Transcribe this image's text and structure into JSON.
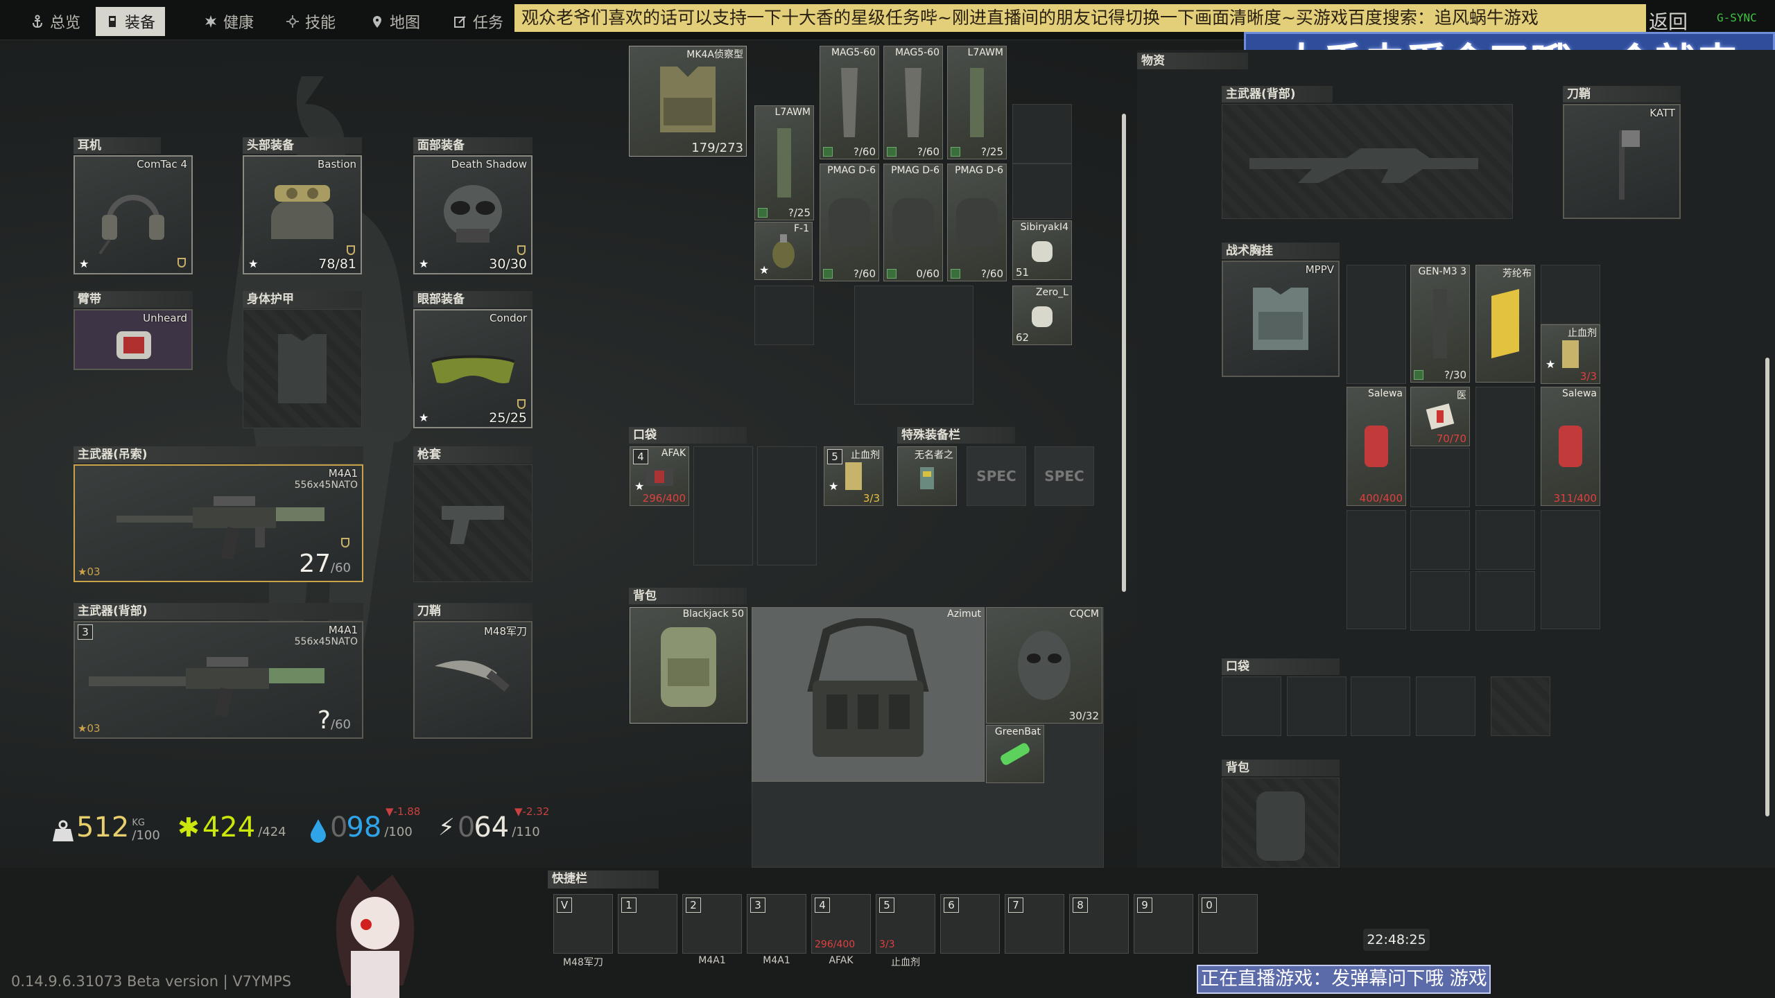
{
  "nav": {
    "tabs": [
      {
        "label": "总览",
        "icon": "anchor-icon",
        "active": false
      },
      {
        "label": "装备",
        "icon": "gear-person-icon",
        "active": true
      },
      {
        "label": "健康",
        "icon": "health-icon",
        "active": false
      },
      {
        "label": "技能",
        "icon": "skills-icon",
        "active": false
      },
      {
        "label": "地图",
        "icon": "map-pin-icon",
        "active": false
      },
      {
        "label": "任务",
        "icon": "tasks-icon",
        "active": false
      }
    ],
    "marquee": "观众老爷们喜欢的话可以支持一下十大香的星级任务哔~刚进直播间的朋友记得切换一下画面清晰度~买游戏百度搜索：追风蜗牛游戏",
    "back": "返回",
    "fps": "G-SYNC"
  },
  "stream": {
    "banner": "大香去觅食了哦一会就来",
    "live_status": "正在直播游戏：发弹幕问下哦 游戏",
    "clock": "22:48:25"
  },
  "gear": {
    "earpiece": {
      "title": "耳机",
      "name": "ComTac 4"
    },
    "headwear": {
      "title": "头部装备",
      "name": "Bastion",
      "value": "78/81"
    },
    "faceCover": {
      "title": "面部装备",
      "name": "Death Shadow",
      "value": "30/30"
    },
    "armband": {
      "title": "臂带",
      "name": "Unheard"
    },
    "bodyArmor": {
      "title": "身体护甲"
    },
    "eyewear": {
      "title": "眼部装备",
      "name": "Condor",
      "value": "25/25"
    },
    "primarySling": {
      "title": "主武器(吊索)",
      "name": "M4A1",
      "caliber": "556x45NATO",
      "ammo": "27",
      "ammoMax": "/60",
      "level": "03"
    },
    "holster": {
      "title": "枪套"
    },
    "primaryBack": {
      "title": "主武器(背部)",
      "name": "M4A1",
      "caliber": "556x45NATO",
      "ammo": "?",
      "ammoMax": "/60",
      "level": "03",
      "key": "3"
    },
    "scabbard": {
      "title": "刀鞘",
      "name": "M48军刀"
    }
  },
  "stats": {
    "weight": "512",
    "weightUnit": "KG",
    "weightMax": "/100",
    "health": "424",
    "healthMax": "/424",
    "hydration": "98",
    "hydrationMax": "/100",
    "hydrationDelta": "▼-1.88",
    "energy": "64",
    "energyMax": "/110",
    "energyDelta": "▼-2.32",
    "prefix": "0"
  },
  "rig": {
    "vest": {
      "name": "MK4A侦察型",
      "value": "179/273"
    },
    "items": [
      {
        "name": "MAG5-60",
        "value": "?/60"
      },
      {
        "name": "MAG5-60",
        "value": "?/60"
      },
      {
        "name": "L7AWM",
        "value": "?/25"
      },
      {
        "name": "L7AWM",
        "value": "?/25"
      },
      {
        "name": "F-1"
      },
      {
        "name": "PMAG D-6",
        "value": "?/60"
      },
      {
        "name": "PMAG D-6",
        "value": "0/60"
      },
      {
        "name": "PMAG D-6",
        "value": "?/60"
      },
      {
        "name": "SibiryakI4",
        "value": "51"
      },
      {
        "name": "Zero_L",
        "value": "62"
      }
    ]
  },
  "pockets": {
    "title": "口袋",
    "afak": {
      "key": "4",
      "name": "AFAK",
      "value": "296/400"
    }
  },
  "special": {
    "title": "特殊装备栏",
    "hemostat": {
      "key": "5",
      "name": "止血剂",
      "value": "3/3"
    },
    "marker": {
      "name": "无名者之"
    },
    "spec1": "SPEC",
    "spec2": "SPEC"
  },
  "backpack": {
    "title": "背包",
    "name": "Blackjack 50",
    "rig": "Azimut",
    "mask": {
      "name": "CQCM",
      "value": "30/32"
    },
    "stim": {
      "name": "GreenBat"
    }
  },
  "stash": {
    "title": "物资",
    "primary": {
      "title": "主武器(背部)"
    },
    "scabbard": {
      "title": "刀鞘",
      "name": "KATT"
    },
    "rig": {
      "title": "战术胸挂",
      "name": "MPPV",
      "items": [
        {
          "name": "GEN-M3 3",
          "value": "?/30"
        },
        {
          "name": "芳纶布"
        },
        {
          "name": "止血剂",
          "value": "3/3"
        },
        {
          "name": "Salewa",
          "value": "400/400"
        },
        {
          "name": "医",
          "value": "70/70"
        },
        {
          "name": "Salewa",
          "value": "311/400"
        }
      ]
    },
    "pockets": {
      "title": "口袋"
    },
    "backpack": {
      "title": "背包"
    }
  },
  "hotbar": {
    "title": "快捷栏",
    "slots": [
      {
        "key": "V",
        "label": "M48军刀"
      },
      {
        "key": "1",
        "label": ""
      },
      {
        "key": "2",
        "label": "M4A1"
      },
      {
        "key": "3",
        "label": "M4A1"
      },
      {
        "key": "4",
        "label": "AFAK",
        "value": "296/400"
      },
      {
        "key": "5",
        "label": "止血剂",
        "value": "3/3"
      },
      {
        "key": "6",
        "label": ""
      },
      {
        "key": "7",
        "label": ""
      },
      {
        "key": "8",
        "label": ""
      },
      {
        "key": "9",
        "label": ""
      },
      {
        "key": "0",
        "label": ""
      }
    ]
  },
  "version": "0.14.9.6.31073 Beta version | V7YMPS"
}
